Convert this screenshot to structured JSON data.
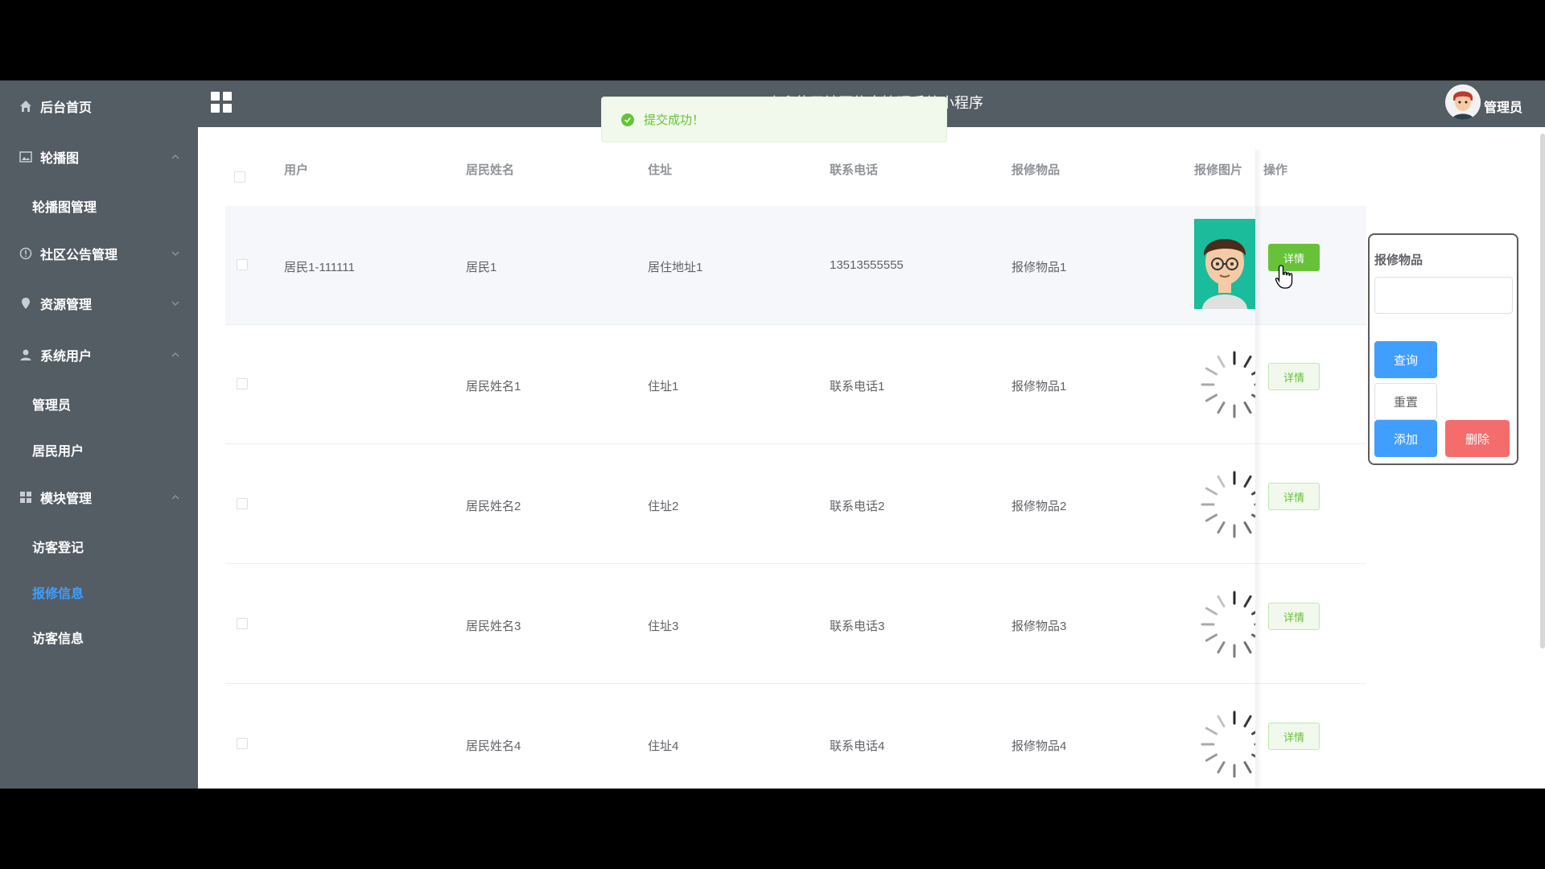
{
  "header": {
    "title": "欢迎使用社区信息管理系统小程序",
    "user": "管理员"
  },
  "toast": {
    "message": "提交成功！"
  },
  "sidebar": {
    "home": "后台首页",
    "carousel": "轮播图",
    "carousel_mgmt": "轮播图管理",
    "notice": "社区公告管理",
    "resource": "资源管理",
    "sysuser": "系统用户",
    "admin": "管理员",
    "resident": "居民用户",
    "module": "模块管理",
    "visitor_reg": "访客登记",
    "repair_info": "报修信息",
    "visitor_info": "访客信息"
  },
  "table": {
    "headers": {
      "user": "用户",
      "name": "居民姓名",
      "address": "住址",
      "phone": "联系电话",
      "item": "报修物品",
      "image": "报修图片",
      "action": "操作"
    },
    "detail_label": "详情",
    "rows": [
      {
        "user": "居民1-111111",
        "name": "居民1",
        "address": "居住地址1",
        "phone": "13513555555",
        "item": "报修物品1"
      },
      {
        "user": "",
        "name": "居民姓名1",
        "address": "住址1",
        "phone": "联系电话1",
        "item": "报修物品1"
      },
      {
        "user": "",
        "name": "居民姓名2",
        "address": "住址2",
        "phone": "联系电话2",
        "item": "报修物品2"
      },
      {
        "user": "",
        "name": "居民姓名3",
        "address": "住址3",
        "phone": "联系电话3",
        "item": "报修物品3"
      },
      {
        "user": "",
        "name": "居民姓名4",
        "address": "住址4",
        "phone": "联系电话4",
        "item": "报修物品4"
      }
    ]
  },
  "search": {
    "label": "报修物品",
    "value": "",
    "query": "查询",
    "reset": "重置",
    "add": "添加",
    "delete": "删除"
  }
}
